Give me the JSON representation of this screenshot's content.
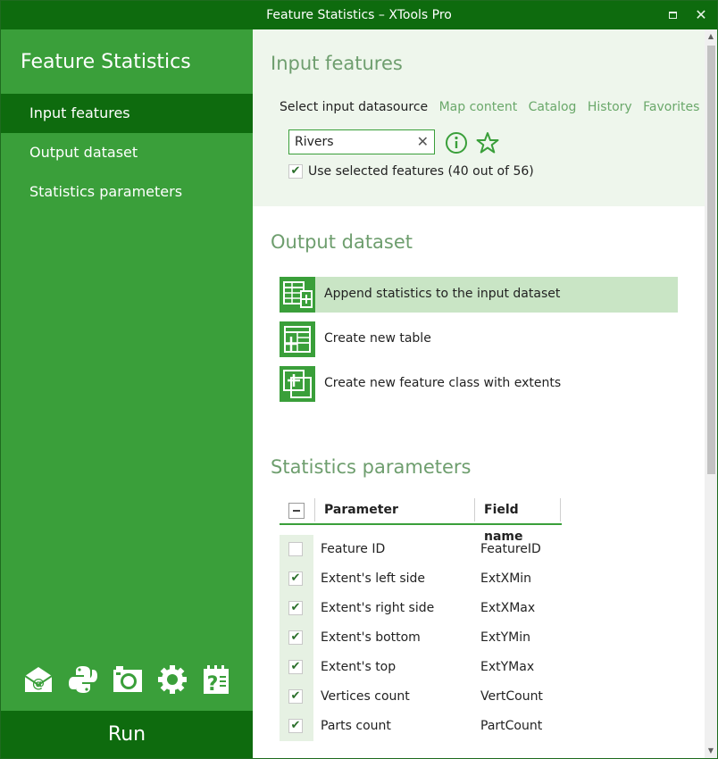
{
  "window": {
    "title": "Feature Statistics – XTools Pro",
    "maximize_glyph": "",
    "close_glyph": "✕"
  },
  "sidebar": {
    "title": "Feature Statistics",
    "items": [
      {
        "label": "Input features",
        "active": true
      },
      {
        "label": "Output dataset",
        "active": false
      },
      {
        "label": "Statistics parameters",
        "active": false
      }
    ],
    "tools": [
      "email-icon",
      "python-icon",
      "camera-icon",
      "gear-icon",
      "help-icon"
    ],
    "run_label": "Run"
  },
  "input": {
    "title": "Input features",
    "datasource_label": "Select input datasource",
    "links": [
      "Map content",
      "Catalog",
      "History",
      "Favorites"
    ],
    "search_value": "Rivers",
    "clear_glyph": "✕",
    "use_selected_label": "Use selected features (40 out of 56)",
    "use_selected_checked": true
  },
  "output": {
    "title": "Output dataset",
    "options": [
      {
        "label": "Append statistics to the input dataset",
        "selected": true,
        "icon": "append-table-icon"
      },
      {
        "label": "Create new table",
        "selected": false,
        "icon": "new-table-icon"
      },
      {
        "label": "Create new feature class with extents",
        "selected": false,
        "icon": "new-feature-class-icon"
      }
    ]
  },
  "stats": {
    "title": "Statistics parameters",
    "columns": {
      "parameter": "Parameter",
      "field": "Field name"
    },
    "rows": [
      {
        "parameter": "Feature ID",
        "field": "FeatureID",
        "checked": false
      },
      {
        "parameter": "Extent's left side",
        "field": "ExtXMin",
        "checked": true
      },
      {
        "parameter": "Extent's right side",
        "field": "ExtXMax",
        "checked": true
      },
      {
        "parameter": "Extent's bottom",
        "field": "ExtYMin",
        "checked": true
      },
      {
        "parameter": "Extent's top",
        "field": "ExtYMax",
        "checked": true
      },
      {
        "parameter": "Vertices count",
        "field": "VertCount",
        "checked": true
      },
      {
        "parameter": "Parts count",
        "field": "PartCount",
        "checked": true
      }
    ]
  },
  "colors": {
    "sidebar": "#3a9f3a",
    "dark_green": "#0e6b0e",
    "section_title": "#6e9e6e",
    "selected_option": "#c9e5c5"
  }
}
